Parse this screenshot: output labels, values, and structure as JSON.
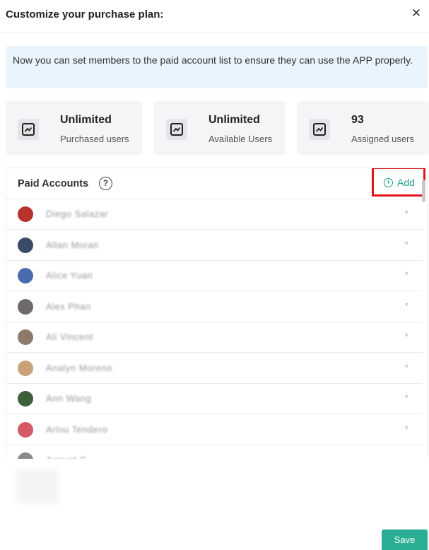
{
  "dialog": {
    "title": "Customize your purchase plan:",
    "close_glyph": "✕"
  },
  "notice": {
    "text": "Now you can set members to the paid account list to ensure they can use the APP properly."
  },
  "stats": [
    {
      "value": "Unlimited",
      "label": "Purchased users",
      "icon": "chart-icon"
    },
    {
      "value": "Unlimited",
      "label": "Available Users",
      "icon": "chart-icon"
    },
    {
      "value": "93",
      "label": "Assigned users",
      "icon": "chart-icon"
    }
  ],
  "paid_accounts": {
    "title": "Paid Accounts",
    "help_glyph": "?",
    "add_label": "Add",
    "add_glyph": "+",
    "remove_glyph": "×",
    "users": [
      {
        "name": "Diego Salazar",
        "avatar_color": "#b8322e"
      },
      {
        "name": "Allan Moran",
        "avatar_color": "#3b4a66"
      },
      {
        "name": "Alice Yuan",
        "avatar_color": "#4a6bb0"
      },
      {
        "name": "Alex Phan",
        "avatar_color": "#6e6a6a"
      },
      {
        "name": "Ali Vincent",
        "avatar_color": "#8d7a6b"
      },
      {
        "name": "Analyn Moreno",
        "avatar_color": "#c7a27a"
      },
      {
        "name": "Ann Wang",
        "avatar_color": "#3e5f3c"
      },
      {
        "name": "Arlou Tendero",
        "avatar_color": "#d55a66"
      },
      {
        "name": "August C",
        "avatar_color": "#8a8a8a"
      }
    ]
  },
  "footer": {
    "save_label": "Save"
  }
}
